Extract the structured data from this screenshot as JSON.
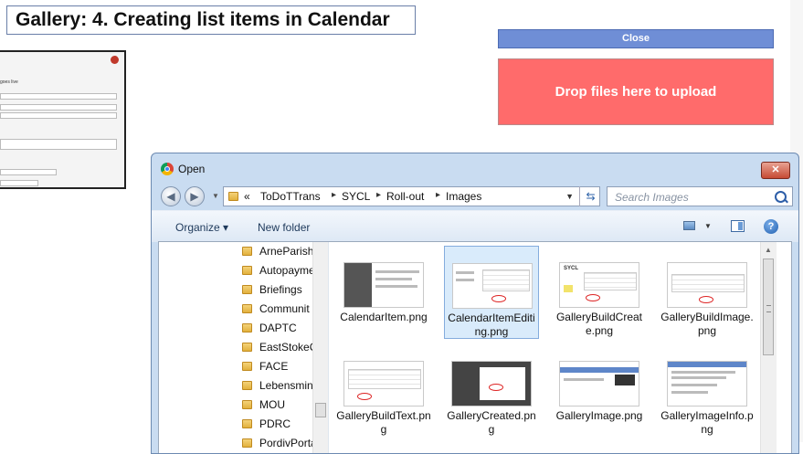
{
  "page": {
    "title": "Gallery: 4. Creating list items in Calendar",
    "close_label": "Close",
    "drop_label": "Drop files here to upload",
    "background_thumb_text": "goes live"
  },
  "dialog": {
    "title": "Open",
    "close_glyph": "✕",
    "breadcrumb": [
      "«",
      "ToDoTTrans",
      "SYCL",
      "Roll-out",
      "Images"
    ],
    "search_placeholder": "Search Images",
    "toolbar": {
      "organize": "Organize ▾",
      "new_folder": "New folder",
      "help": "?"
    },
    "nav_items": [
      "ArneParish",
      "Autopayme",
      "Briefings",
      "Communit",
      "DAPTC",
      "EastStokeC",
      "FACE",
      "Lebensmin",
      "MOU",
      "PDRC",
      "PordivPorta"
    ],
    "files": [
      {
        "name": "CalendarItem.png",
        "selected": false
      },
      {
        "name": "CalendarItemEditing.png",
        "selected": true
      },
      {
        "name": "GalleryBuildCreate.png",
        "selected": false
      },
      {
        "name": "GalleryBuildImage.png",
        "selected": false
      },
      {
        "name": "GalleryBuildText.png",
        "selected": false
      },
      {
        "name": "GalleryCreated.png",
        "selected": false
      },
      {
        "name": "GalleryImage.png",
        "selected": false
      },
      {
        "name": "GalleryImageInfo.png",
        "selected": false
      }
    ]
  },
  "colors": {
    "close_button": "#6f8ed6",
    "drop_zone": "#ff6b6b",
    "selection": "#d9ebfb",
    "dialog_chrome": "#c9dcf1"
  }
}
